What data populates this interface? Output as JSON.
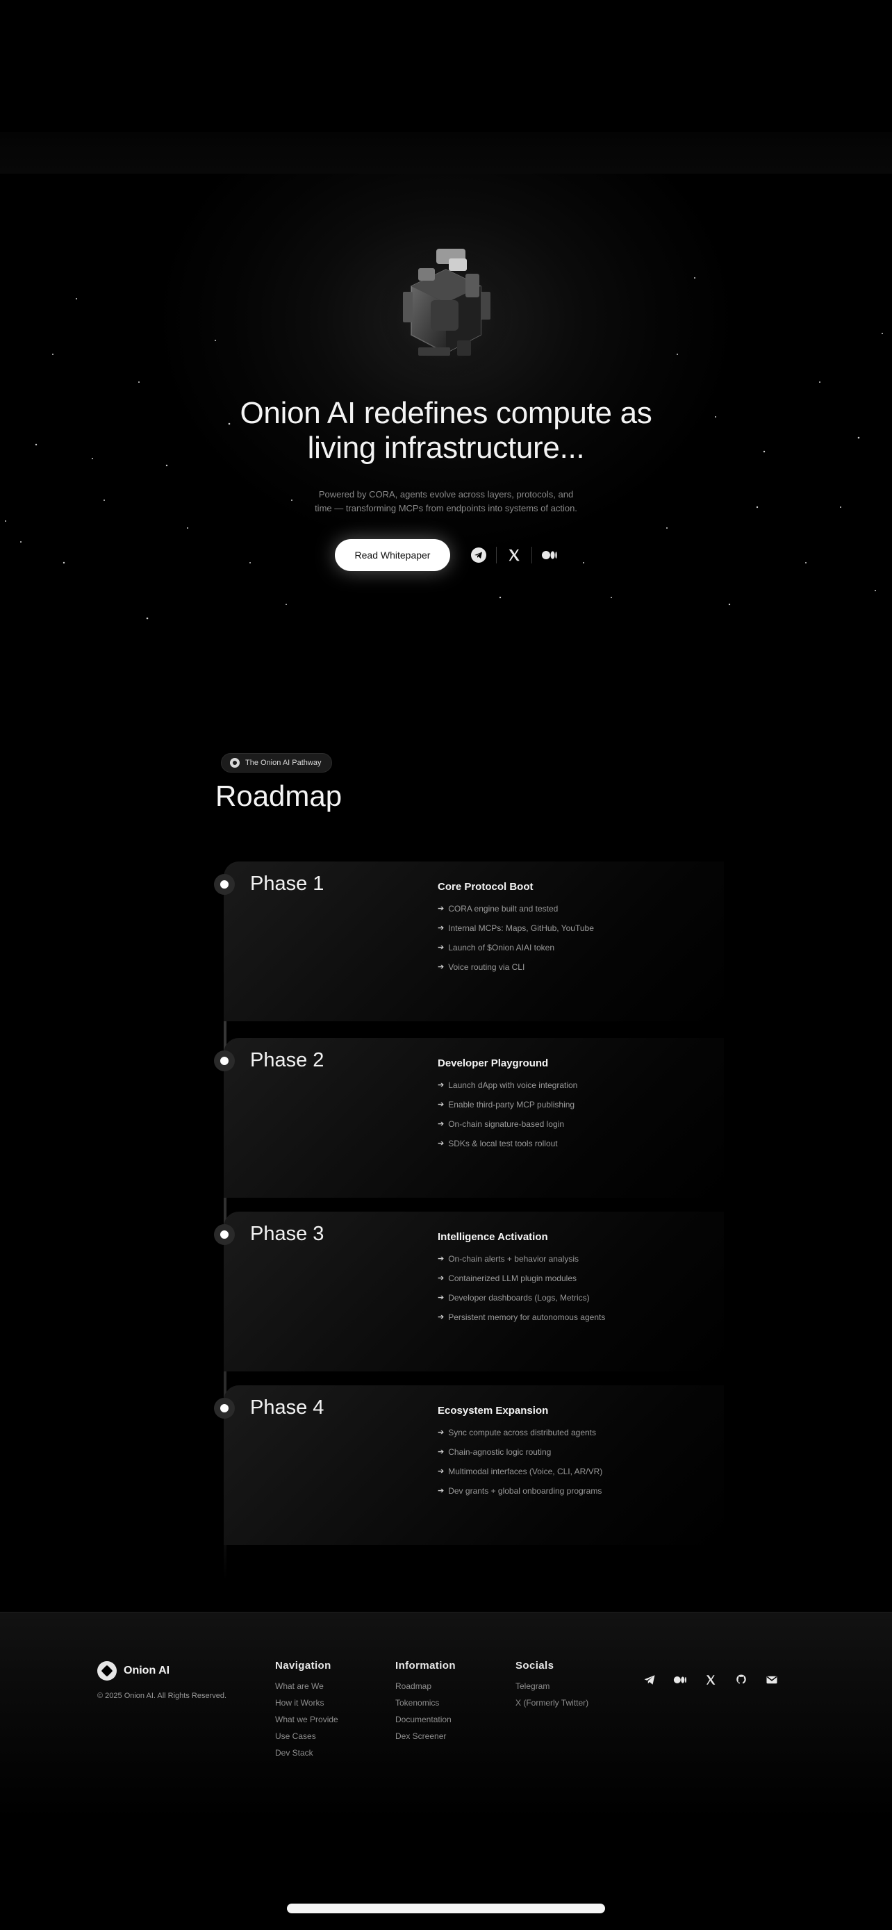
{
  "hero": {
    "title_line1": "Onion AI redefines compute as",
    "title_line2": "living infrastructure...",
    "subtitle_line1": "Powered by CORA, agents evolve across layers, protocols, and",
    "subtitle_line2": "time — transforming MCPs from endpoints into systems of action.",
    "cta_label": "Read Whitepaper",
    "social_icons": [
      "telegram-icon",
      "x-icon",
      "medium-icon"
    ]
  },
  "roadmap": {
    "pill_label": "The Onion AI Pathway",
    "title": "Roadmap",
    "phases": [
      {
        "name": "Phase 1",
        "title": "Core Protocol Boot",
        "items": [
          "CORA engine built and tested",
          "Internal MCPs: Maps, GitHub, YouTube",
          "Launch of $Onion AIAI token",
          "Voice routing via CLI"
        ]
      },
      {
        "name": "Phase 2",
        "title": "Developer Playground",
        "items": [
          "Launch dApp with voice integration",
          "Enable third-party MCP publishing",
          "On-chain signature-based login",
          "SDKs & local test tools rollout"
        ]
      },
      {
        "name": "Phase 3",
        "title": "Intelligence Activation",
        "items": [
          "On-chain alerts + behavior analysis",
          "Containerized LLM plugin modules",
          "Developer dashboards (Logs, Metrics)",
          "Persistent memory for autonomous agents"
        ]
      },
      {
        "name": "Phase 4",
        "title": "Ecosystem Expansion",
        "items": [
          "Sync compute across distributed agents",
          "Chain-agnostic logic routing",
          "Multimodal interfaces (Voice, CLI, AR/VR)",
          "Dev grants + global onboarding programs"
        ]
      }
    ],
    "bullet_glyph": "➔"
  },
  "footer": {
    "brand": "Onion AI",
    "copyright": "© 2025 Onion AI. All Rights Reserved.",
    "navigation": {
      "heading": "Navigation",
      "links": [
        "What are We",
        "How it Works",
        "What we Provide",
        "Use Cases",
        "Dev Stack"
      ]
    },
    "information": {
      "heading": "Information",
      "links": [
        "Roadmap",
        "Tokenomics",
        "Documentation",
        "Dex Screener"
      ]
    },
    "socials": {
      "heading": "Socials",
      "links": [
        "Telegram",
        "X (Formerly Twitter)"
      ]
    },
    "icons": [
      "telegram-icon",
      "medium-icon",
      "x-icon",
      "github-icon",
      "mail-icon"
    ]
  },
  "colors": {
    "background": "#000000",
    "text": "#f4f4f4",
    "muted": "#8a8a8a",
    "button_bg": "#ffffff"
  }
}
